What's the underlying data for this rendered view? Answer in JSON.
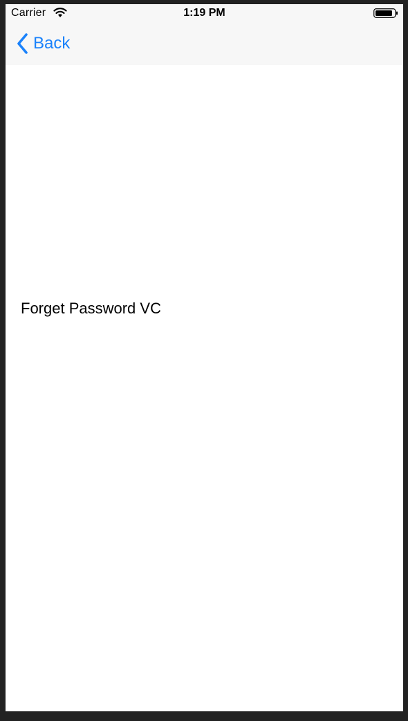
{
  "status_bar": {
    "carrier": "Carrier",
    "time": "1:19 PM",
    "wifi_icon": "wifi-icon",
    "battery_icon": "battery-icon"
  },
  "nav_bar": {
    "back_label": "Back",
    "back_icon": "chevron-left-icon"
  },
  "main": {
    "label": "Forget Password VC"
  },
  "colors": {
    "accent": "#1a82fb",
    "nav_background": "#f7f7f7",
    "page_background": "#ffffff",
    "frame_background": "#222222"
  }
}
